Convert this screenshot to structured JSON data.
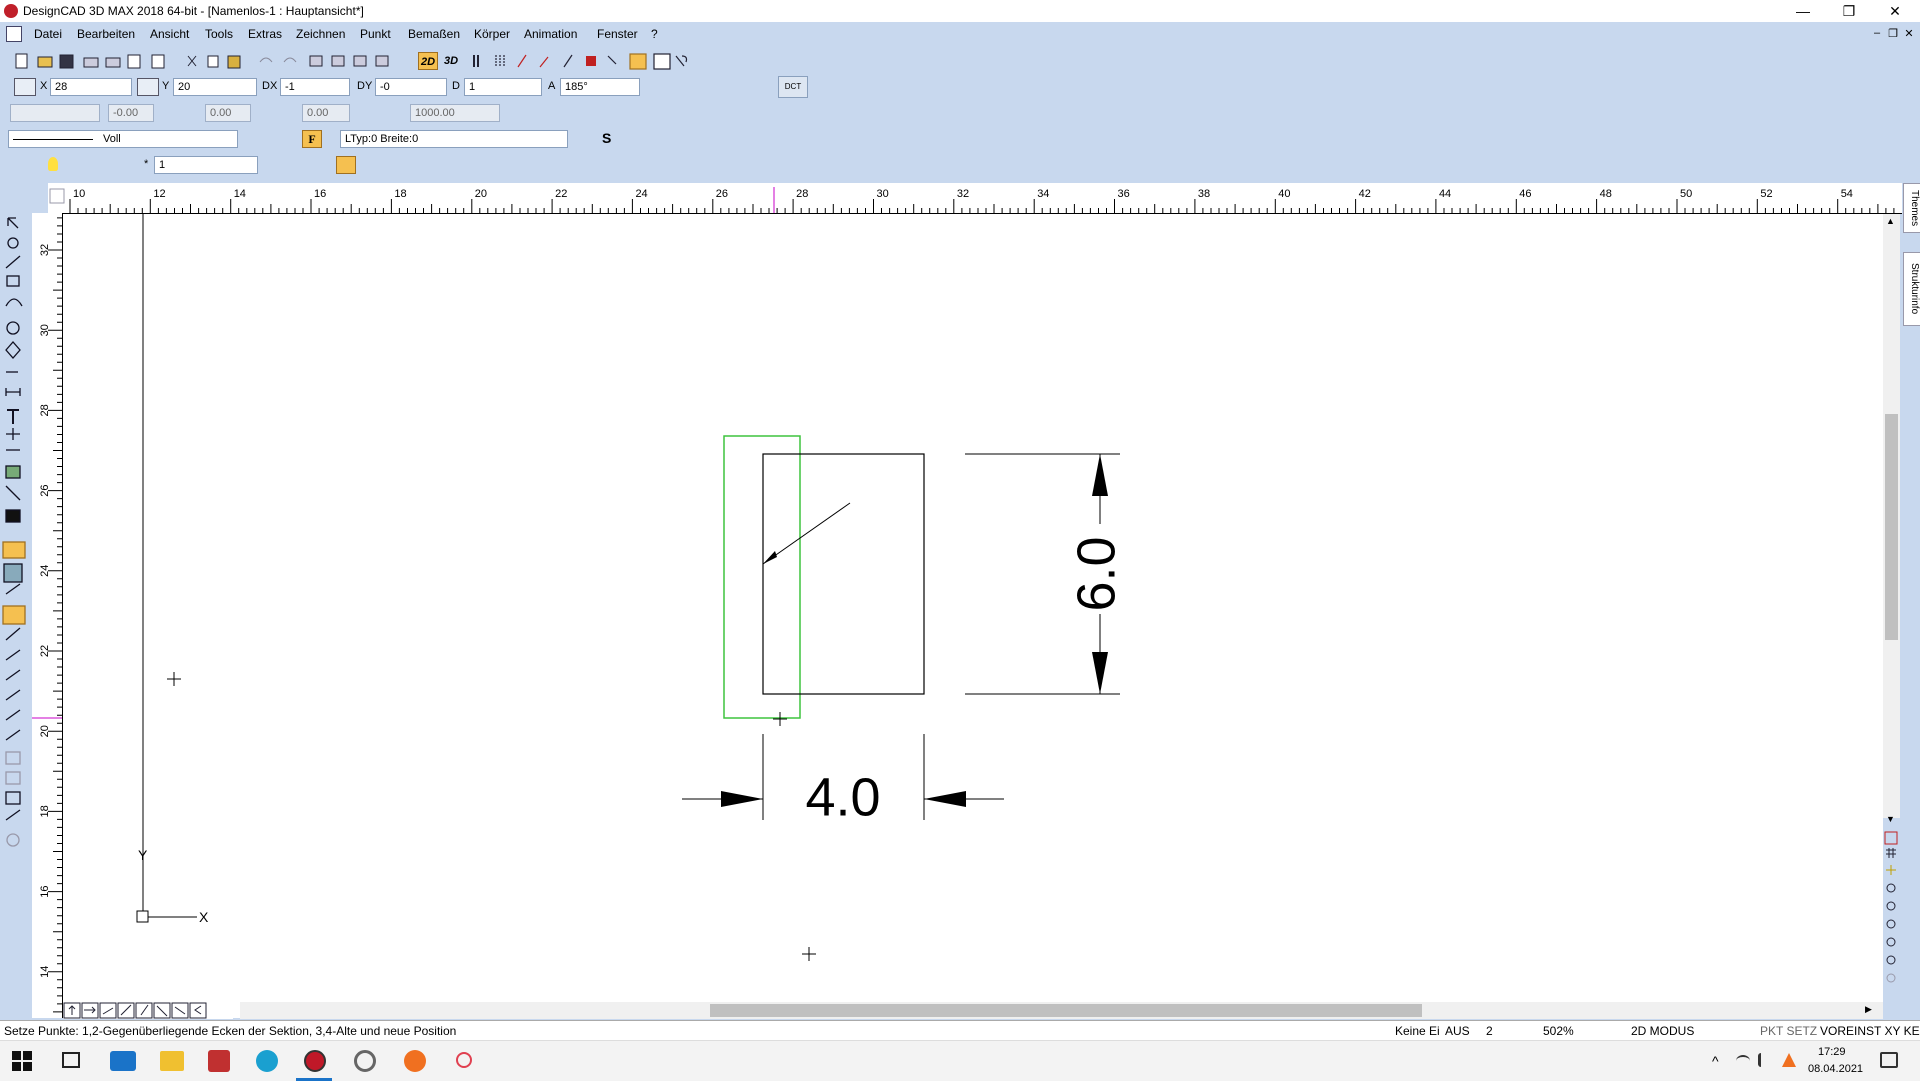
{
  "window": {
    "title": "DesignCAD 3D MAX 2018 64-bit - [Namenlos-1 : Hauptansicht*]",
    "controls": {
      "minimize": "—",
      "maximize": "❐",
      "close": "✕"
    },
    "mdi": {
      "minimize": "–",
      "restore": "❐",
      "close": "✕"
    }
  },
  "menu": [
    "Datei",
    "Bearbeiten",
    "Ansicht",
    "Tools",
    "Extras",
    "Zeichnen",
    "Punkt",
    "Bemaßen",
    "Körper",
    "Animation",
    "Fenster",
    "?"
  ],
  "coords": {
    "x_label": "X",
    "x_value": "28",
    "y_label": "Y",
    "y_value": "20",
    "dx_label": "DX",
    "dx_value": "-1",
    "dy_label": "DY",
    "dy_value": "-0",
    "d_label": "D",
    "d_value": "1",
    "a_label": "A",
    "a_value": "185°",
    "dct_label": "DCT"
  },
  "toolbar3": {
    "v1": "-0.00",
    "v2": "0.00",
    "v3": "0.00",
    "v4": "1000.00"
  },
  "toolbar4": {
    "line_style": "Voll",
    "ltyp": "LTyp:0",
    "breite": "Breite:0",
    "s_btn": "S",
    "f_btn": "F"
  },
  "toolbar5": {
    "layer_star": "*",
    "layer_num": "1"
  },
  "toolbar1": {
    "btn2d": "2D",
    "btn3d": "3D"
  },
  "ruler_top": [
    "10",
    "12",
    "14",
    "16",
    "18",
    "20",
    "22",
    "24",
    "26",
    "28",
    "30",
    "32",
    "34",
    "36",
    "38",
    "40",
    "42",
    "44",
    "46",
    "48",
    "50",
    "52",
    "54"
  ],
  "ruler_left": [
    "32",
    "30",
    "28",
    "26",
    "24",
    "22",
    "20",
    "18",
    "16",
    "14"
  ],
  "drawing": {
    "dim_vertical": "6.0",
    "dim_horizontal": "4.0",
    "axis_y": "Y",
    "axis_x": "X"
  },
  "side_tabs": [
    "Themes",
    "Strukturinfo"
  ],
  "status": {
    "message": "Setze Punkte: 1,2-Gegenüberliegende Ecken der Sektion, 3,4-Alte und neue Position",
    "keine": "Keine Ei",
    "aus": "AUS",
    "num": "2",
    "zoom": "502%",
    "mode": "2D MODUS",
    "pkt": "PKT SETZ",
    "voreinst": "VOREINST XY KE"
  },
  "taskbar": {
    "time": "17:29",
    "date": "08.04.2021"
  },
  "colors": {
    "toolbar_bg": "#c8d8ee",
    "selection_green": "#3ec43e",
    "accent_magenta": "#c800c8"
  }
}
